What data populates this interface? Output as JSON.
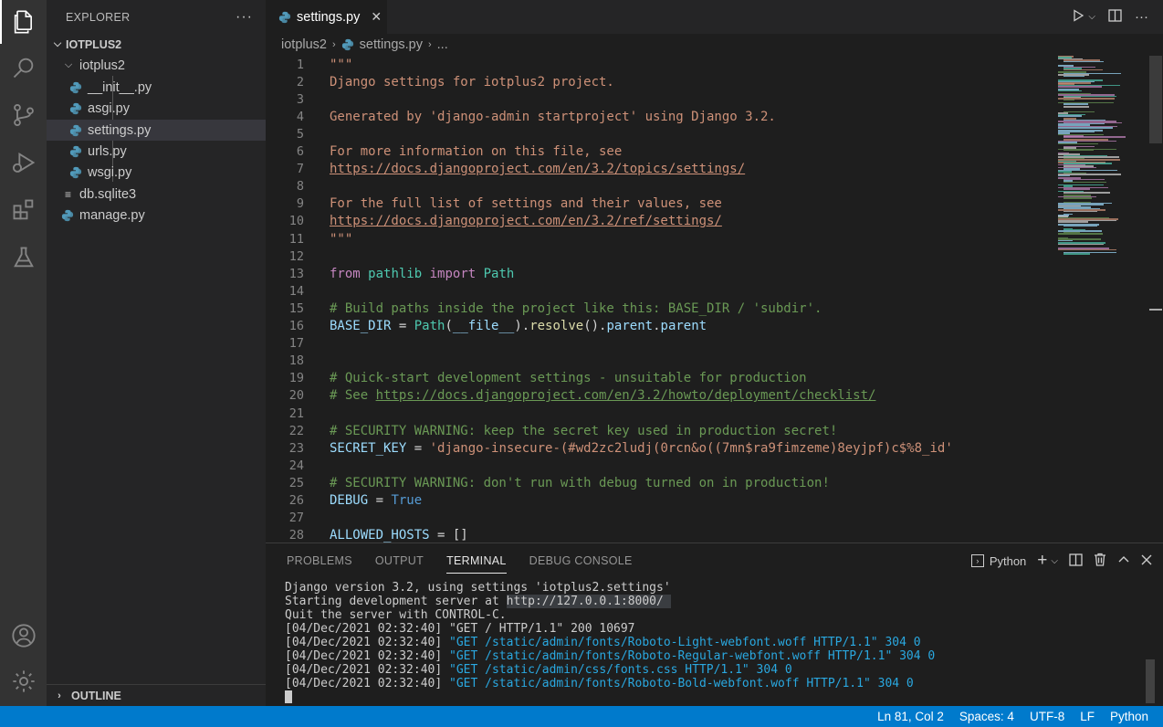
{
  "explorer": {
    "title": "EXPLORER",
    "more": "···",
    "root": "IOTPLUS2",
    "folder": "iotplus2",
    "files": [
      "__init__.py",
      "asgi.py",
      "settings.py",
      "urls.py",
      "wsgi.py"
    ],
    "root_files": [
      "db.sqlite3",
      "manage.py"
    ],
    "outline": "OUTLINE"
  },
  "tab": {
    "label": "settings.py",
    "close": "✕"
  },
  "breadcrumb": {
    "folder": "iotplus2",
    "file": "settings.py",
    "more": "..."
  },
  "editor": {
    "lines": [
      {
        "n": "1",
        "seg": [
          {
            "t": "\"\"\"",
            "c": "str"
          }
        ]
      },
      {
        "n": "2",
        "seg": [
          {
            "t": "Django settings for iotplus2 project.",
            "c": "str"
          }
        ]
      },
      {
        "n": "3",
        "seg": []
      },
      {
        "n": "4",
        "seg": [
          {
            "t": "Generated by 'django-admin startproject' using Django 3.2.",
            "c": "str"
          }
        ]
      },
      {
        "n": "5",
        "seg": []
      },
      {
        "n": "6",
        "seg": [
          {
            "t": "For more information on this file, see",
            "c": "str"
          }
        ]
      },
      {
        "n": "7",
        "seg": [
          {
            "t": "https://docs.djangoproject.com/en/3.2/topics/settings/",
            "c": "str link"
          }
        ]
      },
      {
        "n": "8",
        "seg": []
      },
      {
        "n": "9",
        "seg": [
          {
            "t": "For the full list of settings and their values, see",
            "c": "str"
          }
        ]
      },
      {
        "n": "10",
        "seg": [
          {
            "t": "https://docs.djangoproject.com/en/3.2/ref/settings/",
            "c": "str link"
          }
        ]
      },
      {
        "n": "11",
        "seg": [
          {
            "t": "\"\"\"",
            "c": "str"
          }
        ]
      },
      {
        "n": "12",
        "seg": []
      },
      {
        "n": "13",
        "seg": [
          {
            "t": "from",
            "c": "kw"
          },
          {
            "t": " ",
            "c": ""
          },
          {
            "t": "pathlib",
            "c": "mod"
          },
          {
            "t": " ",
            "c": ""
          },
          {
            "t": "import",
            "c": "kw"
          },
          {
            "t": " ",
            "c": ""
          },
          {
            "t": "Path",
            "c": "mod"
          }
        ]
      },
      {
        "n": "14",
        "seg": []
      },
      {
        "n": "15",
        "seg": [
          {
            "t": "# Build paths inside the project like this: BASE_DIR / 'subdir'.",
            "c": "cmt"
          }
        ]
      },
      {
        "n": "16",
        "seg": [
          {
            "t": "BASE_DIR",
            "c": "var"
          },
          {
            "t": " = ",
            "c": ""
          },
          {
            "t": "Path",
            "c": "mod"
          },
          {
            "t": "(",
            "c": ""
          },
          {
            "t": "__file__",
            "c": "var"
          },
          {
            "t": ").",
            "c": ""
          },
          {
            "t": "resolve",
            "c": "fn"
          },
          {
            "t": "().",
            "c": ""
          },
          {
            "t": "parent",
            "c": "var"
          },
          {
            "t": ".",
            "c": ""
          },
          {
            "t": "parent",
            "c": "var"
          }
        ]
      },
      {
        "n": "17",
        "seg": []
      },
      {
        "n": "18",
        "seg": []
      },
      {
        "n": "19",
        "seg": [
          {
            "t": "# Quick-start development settings - unsuitable for production",
            "c": "cmt"
          }
        ]
      },
      {
        "n": "20",
        "seg": [
          {
            "t": "# See ",
            "c": "cmt"
          },
          {
            "t": "https://docs.djangoproject.com/en/3.2/howto/deployment/checklist/",
            "c": "cmt link"
          }
        ]
      },
      {
        "n": "21",
        "seg": []
      },
      {
        "n": "22",
        "seg": [
          {
            "t": "# SECURITY WARNING: keep the secret key used in production secret!",
            "c": "cmt"
          }
        ]
      },
      {
        "n": "23",
        "seg": [
          {
            "t": "SECRET_KEY",
            "c": "var"
          },
          {
            "t": " = ",
            "c": ""
          },
          {
            "t": "'django-insecure-(#wd2zc2ludj(0rcn&o((7mn$ra9fimzeme)8eyjpf)c$%8_id'",
            "c": "str"
          }
        ]
      },
      {
        "n": "24",
        "seg": []
      },
      {
        "n": "25",
        "seg": [
          {
            "t": "# SECURITY WARNING: don't run with debug turned on in production!",
            "c": "cmt"
          }
        ]
      },
      {
        "n": "26",
        "seg": [
          {
            "t": "DEBUG",
            "c": "var"
          },
          {
            "t": " = ",
            "c": ""
          },
          {
            "t": "True",
            "c": "bool"
          }
        ]
      },
      {
        "n": "27",
        "seg": []
      },
      {
        "n": "28",
        "seg": [
          {
            "t": "ALLOWED_HOSTS",
            "c": "var"
          },
          {
            "t": " = []",
            "c": ""
          }
        ]
      }
    ]
  },
  "panel": {
    "tabs": [
      "PROBLEMS",
      "OUTPUT",
      "TERMINAL",
      "DEBUG CONSOLE"
    ],
    "active_tab": "TERMINAL",
    "shell": "Python",
    "terminal": [
      [
        {
          "t": "Django version 3.2, using settings 'iotplus2.settings'",
          "c": ""
        }
      ],
      [
        {
          "t": "Starting development server at ",
          "c": ""
        },
        {
          "t": "http://127.0.0.1:8000/ ",
          "c": "hl"
        }
      ],
      [
        {
          "t": "Quit the server with CONTROL-C.",
          "c": ""
        }
      ],
      [
        {
          "t": "[04/Dec/2021 02:32:40] \"GET / HTTP/1.1\" 200 10697",
          "c": ""
        }
      ],
      [
        {
          "t": "[04/Dec/2021 02:32:40] ",
          "c": ""
        },
        {
          "t": "\"GET /static/admin/fonts/Roboto-Light-webfont.woff HTTP/1.1\" 304 0",
          "c": "blue"
        }
      ],
      [
        {
          "t": "[04/Dec/2021 02:32:40] ",
          "c": ""
        },
        {
          "t": "\"GET /static/admin/fonts/Roboto-Regular-webfont.woff HTTP/1.1\" 304 0",
          "c": "blue"
        }
      ],
      [
        {
          "t": "[04/Dec/2021 02:32:40] ",
          "c": ""
        },
        {
          "t": "\"GET /static/admin/css/fonts.css HTTP/1.1\" 304 0",
          "c": "blue"
        }
      ],
      [
        {
          "t": "[04/Dec/2021 02:32:40] ",
          "c": ""
        },
        {
          "t": "\"GET /static/admin/fonts/Roboto-Bold-webfont.woff HTTP/1.1\" 304 0",
          "c": "blue"
        }
      ]
    ]
  },
  "status": {
    "position": "Ln 81, Col 2",
    "spaces": "Spaces: 4",
    "encoding": "UTF-8",
    "eol": "LF",
    "language": "Python"
  },
  "colors": {
    "accent": "#007acc",
    "python_icon": "#519aba"
  }
}
